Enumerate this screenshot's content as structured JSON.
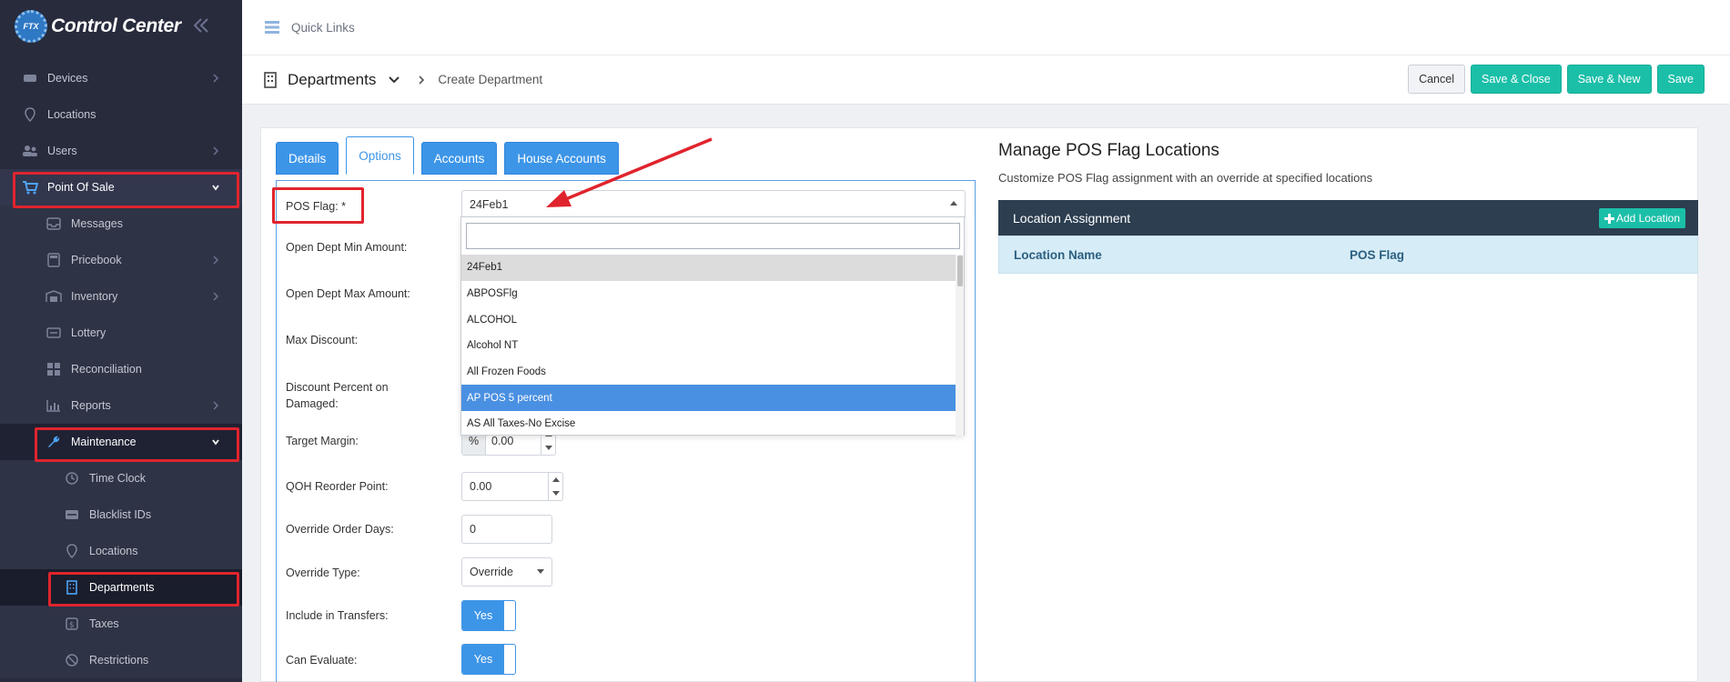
{
  "sidebar": {
    "brand": "Control Center",
    "logo_text": "FTX",
    "items": {
      "devices": "Devices",
      "locations": "Locations",
      "users": "Users",
      "point_of_sale": "Point Of Sale",
      "messages": "Messages",
      "pricebook": "Pricebook",
      "inventory": "Inventory",
      "lottery": "Lottery",
      "reconciliation": "Reconciliation",
      "reports": "Reports",
      "maintenance": "Maintenance",
      "time_clock": "Time Clock",
      "blacklist_ids": "Blacklist IDs",
      "maint_locations": "Locations",
      "departments": "Departments",
      "taxes": "Taxes",
      "restrictions": "Restrictions"
    }
  },
  "topbar": {
    "quick_links": "Quick Links"
  },
  "subbar": {
    "title": "Departments",
    "crumb": "Create Department",
    "cancel": "Cancel",
    "save_close": "Save & Close",
    "save_new": "Save & New",
    "save": "Save"
  },
  "tabs": [
    "Details",
    "Options",
    "Accounts",
    "House Accounts"
  ],
  "form": {
    "pos_flag_label": "POS Flag: *",
    "pos_flag_value": "24Feb1",
    "open_min_label": "Open Dept Min Amount:",
    "open_max_label": "Open Dept Max Amount:",
    "max_discount_label": "Max Discount:",
    "discount_damaged_label_1": "Discount Percent on",
    "discount_damaged_label_2": "Damaged:",
    "target_margin_label": "Target Margin:",
    "target_margin_prefix": "%",
    "target_margin_value": "0.00",
    "qoh_label": "QOH Reorder Point:",
    "qoh_value": "0.00",
    "override_days_label": "Override Order Days:",
    "override_days_value": "0",
    "override_type_label": "Override Type:",
    "override_type_value": "Override",
    "include_transfers_label": "Include in Transfers:",
    "include_transfers_value": "Yes",
    "can_evaluate_label": "Can Evaluate:",
    "can_evaluate_value": "Yes"
  },
  "dropdown": {
    "search_value": "",
    "options": [
      "24Feb1",
      "ABPOSFlg",
      "ALCOHOL",
      "Alcohol NT",
      "All Frozen Foods",
      "AP POS 5 percent",
      "AS All Taxes-No Excise"
    ]
  },
  "right_panel": {
    "title": "Manage POS Flag Locations",
    "subtitle": "Customize POS Flag assignment with an override at specified locations",
    "header": "Location Assignment",
    "add_button": "Add Location",
    "col_location": "Location Name",
    "col_pos_flag": "POS Flag"
  },
  "colors": {
    "sidebar_bg": "#272b3c",
    "accent_blue": "#3d95e8",
    "teal": "#1bbfa8",
    "highlight_red": "#e0242d",
    "table_header": "#2c3e50"
  }
}
